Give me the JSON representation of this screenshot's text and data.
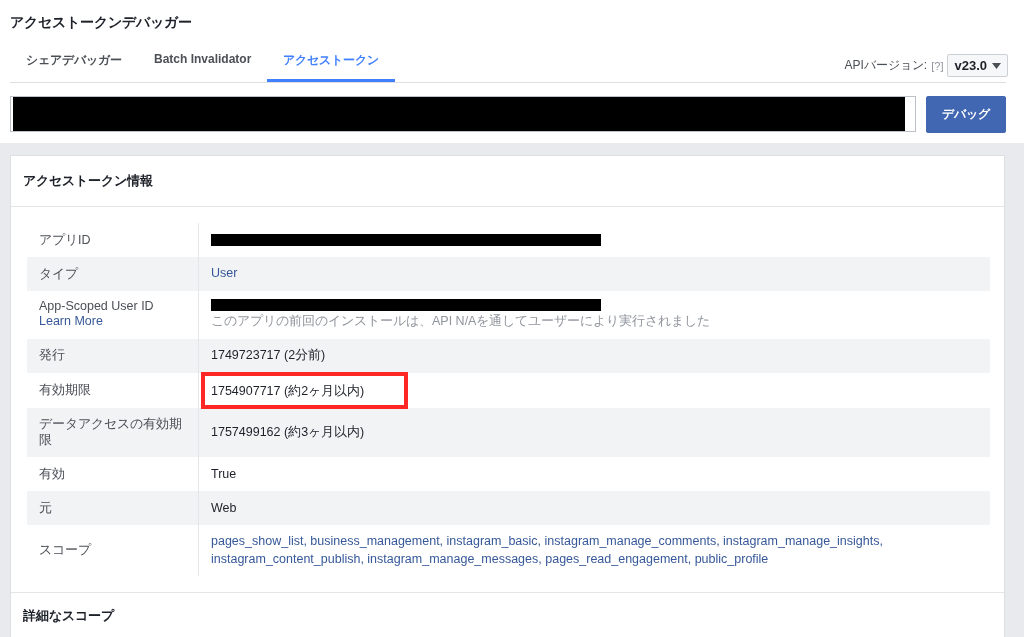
{
  "page_title": "アクセストークンデバッガー",
  "tabs": [
    {
      "label": "シェアデバッガー",
      "selected": false
    },
    {
      "label": "Batch Invalidator",
      "selected": false
    },
    {
      "label": "アクセストークン",
      "selected": true
    }
  ],
  "api_version": {
    "label": "APIバージョン:",
    "help": "[?]",
    "value": "v23.0"
  },
  "token_field": {
    "redacted": true
  },
  "debug_button": "デバッグ",
  "card": {
    "title": "アクセストークン情報",
    "rows": [
      {
        "kind": "redacted",
        "label": "アプリID",
        "highlighted": false
      },
      {
        "kind": "link",
        "label": "タイプ",
        "value": "User",
        "highlighted": false
      },
      {
        "kind": "user_id",
        "label": "App-Scoped User ID",
        "link": "Learn More",
        "note": "このアプリの前回のインストールは、API N/Aを通してユーザーにより実行されました"
      },
      {
        "kind": "text",
        "label": "発行",
        "value": "1749723717 (2分前)",
        "highlighted": false
      },
      {
        "kind": "text",
        "label": "有効期限",
        "value": "1754907717 (約2ヶ月以内)",
        "highlighted": true
      },
      {
        "kind": "text",
        "label": "データアクセスの有効期限",
        "value": "1757499162 (約3ヶ月以内)",
        "highlighted": false
      },
      {
        "kind": "text",
        "label": "有効",
        "value": "True",
        "highlighted": false
      },
      {
        "kind": "text",
        "label": "元",
        "value": "Web",
        "highlighted": false
      },
      {
        "kind": "link",
        "label": "スコープ",
        "value": "pages_show_list, business_management, instagram_basic, instagram_manage_comments, instagram_manage_insights, instagram_content_publish, instagram_manage_messages, pages_read_engagement, public_profile",
        "highlighted": false
      }
    ]
  },
  "next_section": "詳細なスコープ"
}
